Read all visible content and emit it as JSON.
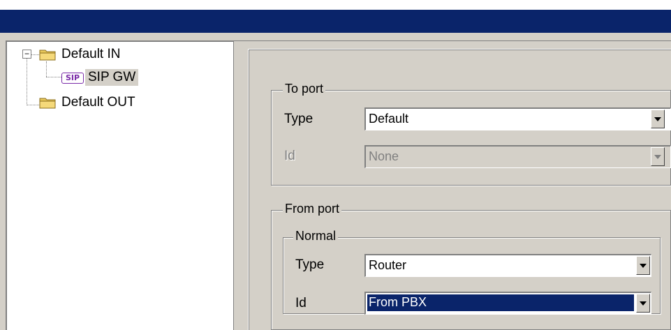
{
  "tree": {
    "items": [
      {
        "label": "Default IN",
        "expander": "−"
      },
      {
        "label": "SIP GW",
        "icon_text": "SIP"
      },
      {
        "label": "Default OUT"
      }
    ]
  },
  "to_port": {
    "title": "To port",
    "type_label": "Type",
    "type_value": "Default",
    "id_label": "Id",
    "id_value": "None"
  },
  "from_port": {
    "title": "From port",
    "normal": {
      "title": "Normal",
      "type_label": "Type",
      "type_value": "Router",
      "id_label": "Id",
      "id_value": "From PBX"
    }
  },
  "colors": {
    "titlebar": "#0a246a",
    "face": "#d4d0c8",
    "selection": "#0a246a",
    "sip_icon": "#7a2aa8"
  }
}
